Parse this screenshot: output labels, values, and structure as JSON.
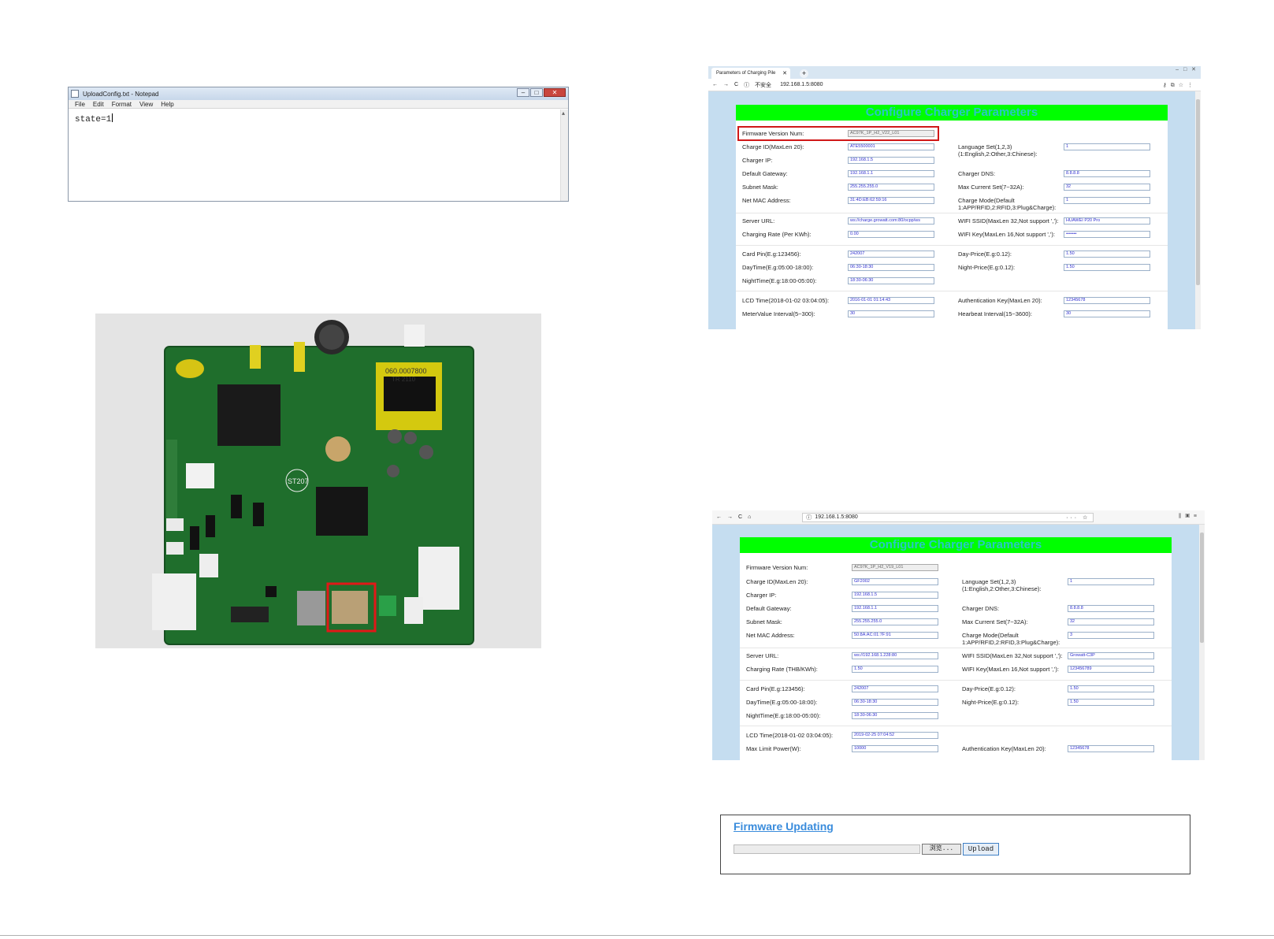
{
  "notepad": {
    "title": "UploadConfig.txt - Notepad",
    "menu": [
      "File",
      "Edit",
      "Format",
      "View",
      "Help"
    ],
    "content": "state=1"
  },
  "browser1": {
    "tab_title": "Parameters of Charging Pile",
    "url_prefix": "不安全",
    "url": "192.168.1.5:8080",
    "banner": "Configure Charger Parameters",
    "left": [
      {
        "label": "Firmware Version Num:",
        "value": "AC97K_1P_H2_V22_L01",
        "readonly": true
      },
      {
        "label": "Charge ID(MaxLen 20):",
        "value": "ATE5500001"
      },
      {
        "label": "Charger IP:",
        "value": "192.168.1.5"
      },
      {
        "label": "Default Gateway:",
        "value": "192.168.1.1"
      },
      {
        "label": "Subnet Mask:",
        "value": "255.255.255.0"
      },
      {
        "label": "Net MAC Address:",
        "value": "31:4D:EB:62:59:16"
      },
      {
        "label": "Server URL:",
        "value": "ws://charge.growatt.com:80/ocpp/ws"
      },
      {
        "label": "Charging Rate (Per KWh):",
        "value": "0.00"
      },
      {
        "label": "Card Pin(E.g:123456):",
        "value": "242007"
      },
      {
        "label": "DayTime(E.g:05:00-18:00):",
        "value": "06:30-18:30"
      },
      {
        "label": "NightTime(E.g:18:00-05:00):",
        "value": "18:30-06:30"
      },
      {
        "label": "LCD Time(2018-01-02 03:04:05):",
        "value": "2016-01-01 01:14:43"
      },
      {
        "label": "MeterValue Interval(5~300):",
        "value": "30"
      }
    ],
    "right": [
      {
        "label": "Language Set(1,2,3)\n(1:English,2:Other,3:Chinese):",
        "value": "1"
      },
      {
        "label": "Charger DNS:",
        "value": "8.8.8.8"
      },
      {
        "label": "Max Current Set(7~32A):",
        "value": "32"
      },
      {
        "label": "Charge Mode(Default\n1:APP/RFID,2:RFID,3:Plug&Charge):",
        "value": "1"
      },
      {
        "label": "WIFI SSID(MaxLen 32,Not support ','):",
        "value": "HUAWEI P20 Pro"
      },
      {
        "label": "WIFI Key(MaxLen 16,Not support ','):",
        "value": "•••••••"
      },
      {
        "label": "Day-Price(E.g:0.12):",
        "value": "1.50"
      },
      {
        "label": "Night-Price(E.g:0.12):",
        "value": "1.50"
      },
      {
        "label": "Authentication Key(MaxLen 20):",
        "value": "12345678"
      },
      {
        "label": "Hearbeat Interval(15~3600):",
        "value": "30"
      }
    ]
  },
  "browser2": {
    "url": "192.168.1.5:8080",
    "banner": "Configure Charger Parameters",
    "left": [
      {
        "label": "Firmware Version Num:",
        "value": "AC97K_1P_H2_V19_L01",
        "readonly": true
      },
      {
        "label": "Charge ID(MaxLen 20):",
        "value": "GF2002"
      },
      {
        "label": "Charger IP:",
        "value": "192.168.1.5"
      },
      {
        "label": "Default Gateway:",
        "value": "192.168.1.1"
      },
      {
        "label": "Subnet Mask:",
        "value": "255.255.255.0"
      },
      {
        "label": "Net MAC Address:",
        "value": "50:8A:AC:01:7F:91"
      },
      {
        "label": "Server URL:",
        "value": "ws://192.168.1.228:80"
      },
      {
        "label": "Charging Rate (THB/KWh):",
        "value": "1.50"
      },
      {
        "label": "Card Pin(E.g:123456):",
        "value": "242007"
      },
      {
        "label": "DayTime(E.g:05:00-18:00):",
        "value": "06:30-18:30"
      },
      {
        "label": "NightTime(E.g:18:00-05:00):",
        "value": "18:30-06:30"
      },
      {
        "label": "LCD Time(2018-01-02 03:04:05):",
        "value": "2019-02-25 07:04:52"
      },
      {
        "label": "Max Limit Power(W):",
        "value": "10000"
      }
    ],
    "right": [
      {
        "label": "Language Set(1,2,3)\n(1:English,2:Other,3:Chinese):",
        "value": "1"
      },
      {
        "label": "Charger DNS:",
        "value": "8.8.8.8"
      },
      {
        "label": "Max Current Set(7~32A):",
        "value": "32"
      },
      {
        "label": "Charge Mode(Default\n1:APP/RFID,2:RFID,3:Plug&Charge):",
        "value": "3"
      },
      {
        "label": "WIFI SSID(MaxLen 32,Not support ','):",
        "value": "Growatt-C3P"
      },
      {
        "label": "WIFI Key(MaxLen 16,Not support ','):",
        "value": "123456789"
      },
      {
        "label": "Day-Price(E.g:0.12):",
        "value": "1.50"
      },
      {
        "label": "Night-Price(E.g:0.12):",
        "value": "1.50"
      },
      {
        "label": "Authentication Key(MaxLen 20):",
        "value": "12345678"
      }
    ]
  },
  "pcb_labels": {
    "transformer": "060.0007800\nTR    2110",
    "chip": "ST207"
  },
  "firmware": {
    "title": "Firmware Updating",
    "browse_label": "浏览...",
    "upload_label": "Upload"
  },
  "colors": {
    "banner_bg": "#00ff00",
    "banner_text": "#28c6c6",
    "highlight_box": "#d01818",
    "pcb_green": "#1e6b2a",
    "link_blue": "#3a8cdc"
  }
}
